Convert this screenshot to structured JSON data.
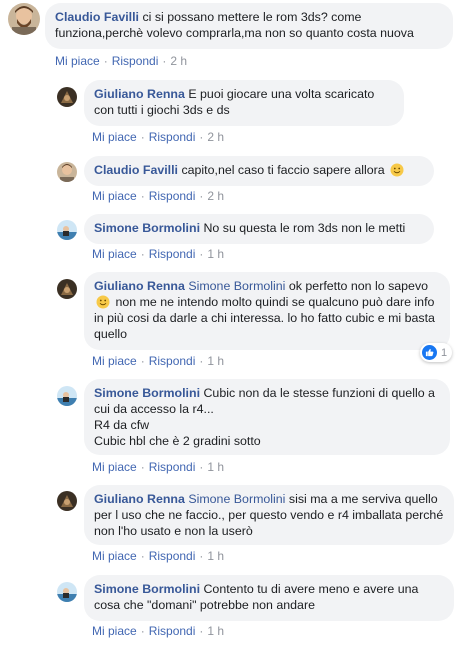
{
  "comments": [
    {
      "author": "Claudio Favilli",
      "text": "ci si possano mettere le rom 3ds? come funziona,perchè volevo comprarla,ma non so quanto costa nuova",
      "like_label": "Mi piace",
      "reply_label": "Rispondi",
      "time": "2 h"
    },
    {
      "author": "Giuliano Renna",
      "text": "E puoi giocare una volta scaricato con tutti i giochi 3ds e ds",
      "like_label": "Mi piace",
      "reply_label": "Rispondi",
      "time": "2 h"
    },
    {
      "author": "Claudio Favilli",
      "text": "capito,nel caso ti faccio sapere allora",
      "like_label": "Mi piace",
      "reply_label": "Rispondi",
      "time": "2 h"
    },
    {
      "author": "Simone Bormolini",
      "text": "No su questa le rom 3ds non le metti",
      "like_label": "Mi piace",
      "reply_label": "Rispondi",
      "time": "1 h"
    },
    {
      "author": "Giuliano Renna",
      "mention": "Simone Bormolini",
      "text_a": "ok perfetto non lo sapevo",
      "text_b": "non me ne intendo molto quindi se qualcuno può dare info in più cosi da darle a chi interessa. lo ho fatto cubic e mi basta quello",
      "like_label": "Mi piace",
      "reply_label": "Rispondi",
      "time": "1 h",
      "reaction_count": "1"
    },
    {
      "author": "Simone Bormolini",
      "text_line1": "Cubic non da le stesse funzioni di quello a cui da accesso la r4...",
      "text_line2": "R4 da cfw",
      "text_line3": "Cubic hbl che è 2 gradini sotto",
      "like_label": "Mi piace",
      "reply_label": "Rispondi",
      "time": "1 h"
    },
    {
      "author": "Giuliano Renna",
      "mention": "Simone Bormolini",
      "text": "sisi ma a me serviva quello per l uso che ne faccio., per questo vendo e r4 imballata perché non l'ho usato e non la userò",
      "like_label": "Mi piace",
      "reply_label": "Rispondi",
      "time": "1 h"
    },
    {
      "author": "Simone Bormolini",
      "text": "Contento tu di avere meno e avere una cosa che \"domani\" potrebbe non andare",
      "like_label": "Mi piace",
      "reply_label": "Rispondi",
      "time": "1 h"
    }
  ],
  "colors": {
    "link": "#385898",
    "action": "#4267b2",
    "bubble": "#f2f3f5",
    "muted": "#90949c",
    "like": "#1877f2"
  },
  "icons": {
    "smile": "smile-emoji-icon",
    "like": "thumbs-up-icon"
  }
}
